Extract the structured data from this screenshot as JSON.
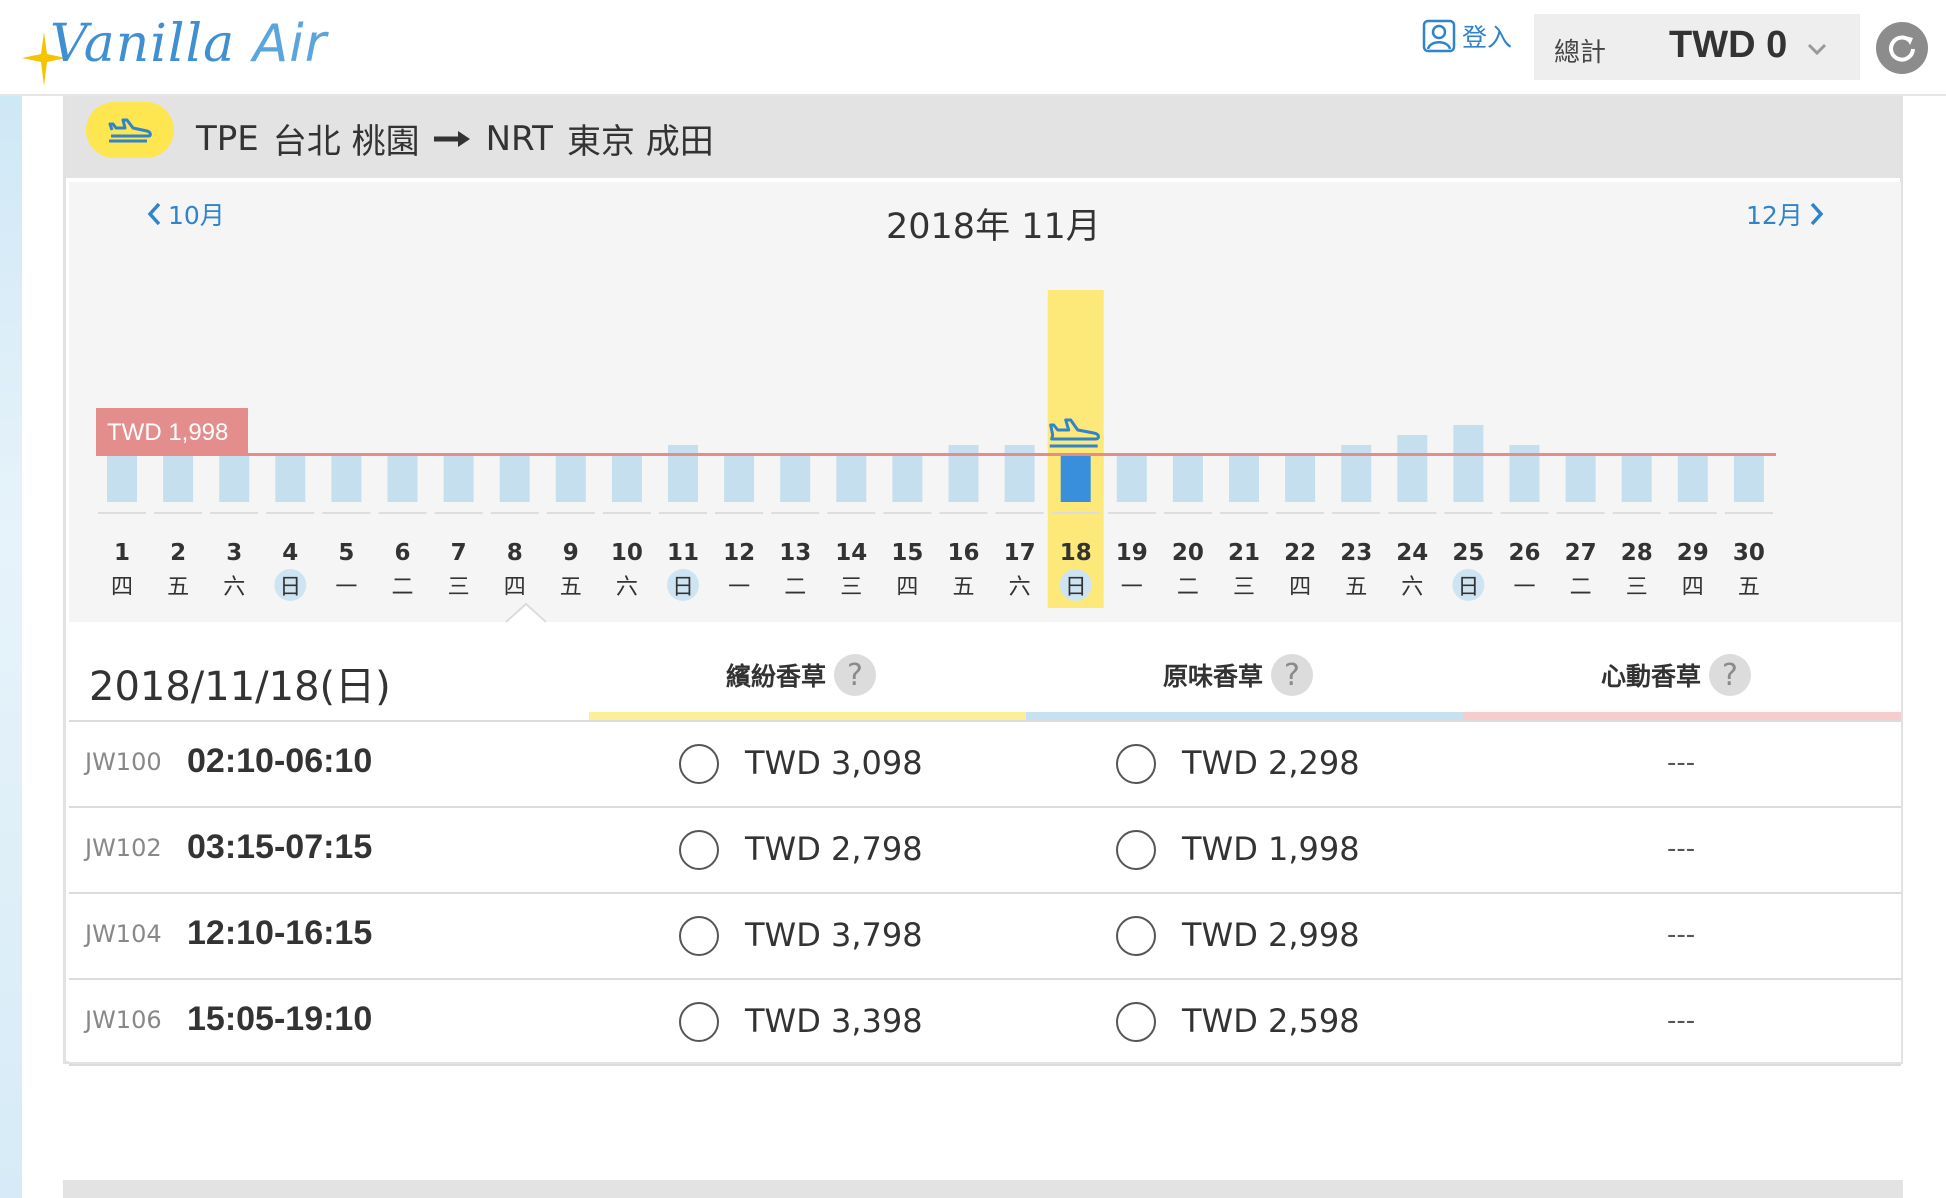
{
  "header": {
    "logo_main": "Vanilla",
    "logo_sub": "Air",
    "login_label": "登入",
    "total_label": "總計",
    "total_value": "TWD 0"
  },
  "route": {
    "from_code": "TPE",
    "from_name": "台北 桃園",
    "to_code": "NRT",
    "to_name": "東京 成田"
  },
  "calendar": {
    "prev_month": "10月",
    "next_month": "12月",
    "title": "2018年 11月",
    "lowest_price_label": "TWD 1,998",
    "selected_day": 18,
    "days": [
      {
        "d": "1",
        "wd": "四",
        "level": 1,
        "sun": false
      },
      {
        "d": "2",
        "wd": "五",
        "level": 1,
        "sun": false
      },
      {
        "d": "3",
        "wd": "六",
        "level": 1,
        "sun": false
      },
      {
        "d": "4",
        "wd": "日",
        "level": 1,
        "sun": true
      },
      {
        "d": "5",
        "wd": "一",
        "level": 1,
        "sun": false
      },
      {
        "d": "6",
        "wd": "二",
        "level": 1,
        "sun": false
      },
      {
        "d": "7",
        "wd": "三",
        "level": 1,
        "sun": false
      },
      {
        "d": "8",
        "wd": "四",
        "level": 1,
        "sun": false
      },
      {
        "d": "9",
        "wd": "五",
        "level": 1,
        "sun": false
      },
      {
        "d": "10",
        "wd": "六",
        "level": 1,
        "sun": false
      },
      {
        "d": "11",
        "wd": "日",
        "level": 2,
        "sun": true
      },
      {
        "d": "12",
        "wd": "一",
        "level": 1,
        "sun": false
      },
      {
        "d": "13",
        "wd": "二",
        "level": 1,
        "sun": false
      },
      {
        "d": "14",
        "wd": "三",
        "level": 1,
        "sun": false
      },
      {
        "d": "15",
        "wd": "四",
        "level": 1,
        "sun": false
      },
      {
        "d": "16",
        "wd": "五",
        "level": 2,
        "sun": false
      },
      {
        "d": "17",
        "wd": "六",
        "level": 2,
        "sun": false
      },
      {
        "d": "18",
        "wd": "日",
        "level": 1,
        "sun": true
      },
      {
        "d": "19",
        "wd": "一",
        "level": 1,
        "sun": false
      },
      {
        "d": "20",
        "wd": "二",
        "level": 1,
        "sun": false
      },
      {
        "d": "21",
        "wd": "三",
        "level": 1,
        "sun": false
      },
      {
        "d": "22",
        "wd": "四",
        "level": 1,
        "sun": false
      },
      {
        "d": "23",
        "wd": "五",
        "level": 2,
        "sun": false
      },
      {
        "d": "24",
        "wd": "六",
        "level": 3,
        "sun": false
      },
      {
        "d": "25",
        "wd": "日",
        "level": 4,
        "sun": true
      },
      {
        "d": "26",
        "wd": "一",
        "level": 2,
        "sun": false
      },
      {
        "d": "27",
        "wd": "二",
        "level": 1,
        "sun": false
      },
      {
        "d": "28",
        "wd": "三",
        "level": 1,
        "sun": false
      },
      {
        "d": "29",
        "wd": "四",
        "level": 1,
        "sun": false
      },
      {
        "d": "30",
        "wd": "五",
        "level": 1,
        "sun": false
      }
    ]
  },
  "fares": {
    "selected_date": "2018/11/18(日)",
    "columns": [
      {
        "label": "繽紛香草",
        "color": "#fbef9a"
      },
      {
        "label": "原味香草",
        "color": "#c8e1f0"
      },
      {
        "label": "心動香草",
        "color": "#f6cccc"
      }
    ],
    "rows": [
      {
        "flight": "JW100",
        "time": "02:10-06:10",
        "fare1": "TWD 3,098",
        "fare2": "TWD 2,298",
        "fare3": "---"
      },
      {
        "flight": "JW102",
        "time": "03:15-07:15",
        "fare1": "TWD 2,798",
        "fare2": "TWD 1,998",
        "fare3": "---"
      },
      {
        "flight": "JW104",
        "time": "12:10-16:15",
        "fare1": "TWD 3,798",
        "fare2": "TWD 2,998",
        "fare3": "---"
      },
      {
        "flight": "JW106",
        "time": "15:05-19:10",
        "fare1": "TWD 3,398",
        "fare2": "TWD 2,598",
        "fare3": "---"
      }
    ]
  },
  "colors": {
    "accent_blue": "#2f84cc",
    "bar_blue": "#c5dfee",
    "bar_selected": "#3a8fdc",
    "highlight_yellow": "#fde97a",
    "low_price_line": "#e38d8d"
  }
}
